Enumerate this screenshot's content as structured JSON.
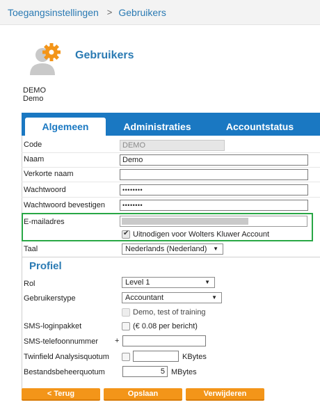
{
  "breadcrumb": {
    "parent": "Toegangsinstellingen",
    "separator": ">",
    "current": "Gebruikers"
  },
  "header": {
    "title": "Gebruikers",
    "user_code": "DEMO",
    "user_name": "Demo"
  },
  "tabs": [
    {
      "label": "Algemeen",
      "active": true
    },
    {
      "label": "Administraties",
      "active": false
    },
    {
      "label": "Accountstatus",
      "active": false
    }
  ],
  "form": {
    "code": {
      "label": "Code",
      "value": "DEMO"
    },
    "naam": {
      "label": "Naam",
      "value": "Demo"
    },
    "verkorte_naam": {
      "label": "Verkorte naam",
      "value": ""
    },
    "wachtwoord": {
      "label": "Wachtwoord",
      "value": "••••••••"
    },
    "wachtwoord_bevestigen": {
      "label": "Wachtwoord bevestigen",
      "value": "••••••••"
    },
    "email": {
      "label": "E-mailadres",
      "invite_label": "Uitnodigen voor Wolters Kluwer Account",
      "invite_checked": true
    },
    "taal": {
      "label": "Taal",
      "value": "Nederlands (Nederland)"
    }
  },
  "profiel": {
    "title": "Profiel",
    "rol": {
      "label": "Rol",
      "value": "Level 1"
    },
    "gebruikerstype": {
      "label": "Gebruikerstype",
      "value": "Accountant"
    },
    "demo_training": {
      "label": "Demo, test of training"
    },
    "sms_pakket": {
      "label": "SMS-loginpakket",
      "note": "(€ 0.08 per bericht)"
    },
    "sms_nummer": {
      "label": "SMS-telefoonnummer",
      "prefix": "+",
      "value": ""
    },
    "analysis_quotum": {
      "label": "Twinfield Analysisquotum",
      "value": "",
      "unit": "KBytes"
    },
    "bestandsbeheer_quotum": {
      "label": "Bestandsbeheerquotum",
      "value": "5",
      "unit": "MBytes"
    }
  },
  "buttons": {
    "back": "< Terug",
    "save": "Opslaan",
    "delete": "Verwijderen"
  },
  "colors": {
    "accent_blue": "#1a78c2",
    "title_blue": "#2a7ab3",
    "button_orange": "#f39519",
    "highlight_green": "#28a745"
  }
}
